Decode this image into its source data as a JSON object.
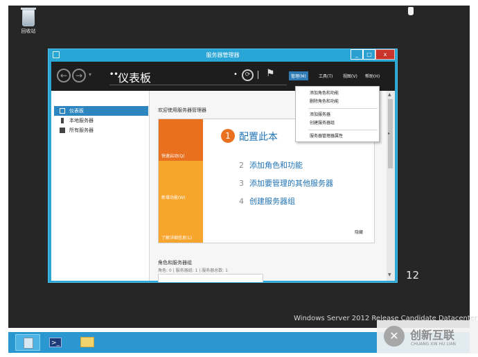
{
  "desktop": {
    "recycle_bin_label": "回收站",
    "edition_text": "Windows Server 2012 Release Candidate Datacenter",
    "big_number": "12",
    "background_color": "#262626"
  },
  "window": {
    "title": "服务器管理器",
    "accent_color": "#29a5d6",
    "controls": {
      "minimize": "_",
      "maximize": "□",
      "close": "x"
    }
  },
  "toolbar": {
    "back_icon": "←",
    "forward_icon": "→",
    "dropdown_icon": "▾",
    "dots": "••",
    "breadcrumb_title": "仪表板",
    "refresh_prefix": "•",
    "refresh_icon": "⟳",
    "flag_icon": "⚑",
    "menus": {
      "manage": "管理(M)",
      "tools": "工具(T)",
      "view": "视图(V)",
      "help": "帮助(H)"
    }
  },
  "sidebar": {
    "items": [
      {
        "label": "仪表板",
        "selected": true
      },
      {
        "label": "本地服务器",
        "selected": false
      },
      {
        "label": "所有服务器",
        "selected": false
      }
    ]
  },
  "main": {
    "welcome_header": "欢迎使用服务器管理器",
    "tiles": {
      "quickstart": "快速启动(Q)",
      "whatsnew": "新增功能(W)",
      "learnmore": "了解详细信息(L)"
    },
    "configure": {
      "number": "1",
      "text": "配置此本"
    },
    "steps": [
      {
        "num": "2",
        "text": "添加角色和功能"
      },
      {
        "num": "3",
        "text": "添加要管理的其他服务器"
      },
      {
        "num": "4",
        "text": "创建服务器组"
      }
    ],
    "hide_link": "隐藏",
    "roles_heading": "角色和服务器组",
    "roles_counts": "角色: 0 | 服务器组: 1 | 服务器总数: 1"
  },
  "dropdown": {
    "items": [
      "添加角色和功能",
      "删除角色和功能",
      "添加服务器",
      "创建服务器组",
      "服务器管理器属性"
    ]
  },
  "watermark": {
    "logo": "✕",
    "name": "创新互联",
    "sub": "CHUANG XIN HU LIAN"
  },
  "taskbar": {
    "powershell_glyph": ">_"
  }
}
